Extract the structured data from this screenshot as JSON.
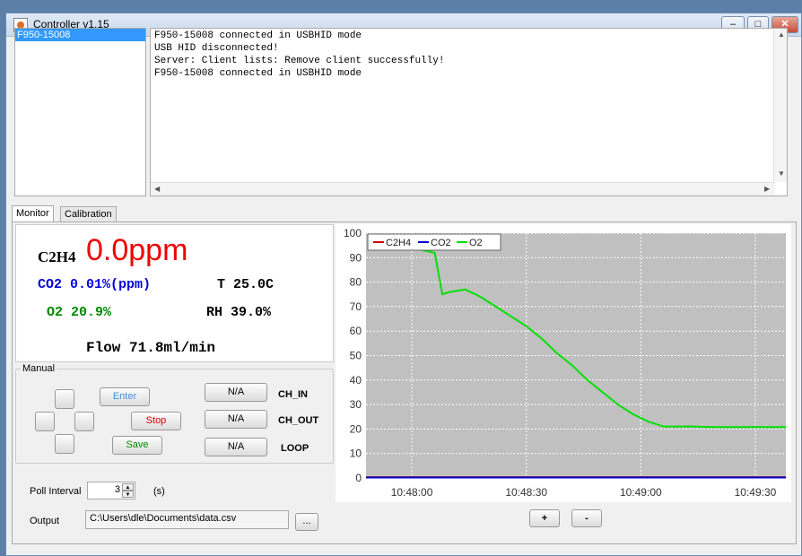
{
  "window": {
    "title": "Controller v1.15",
    "minimize": "–",
    "maximize": "□",
    "close": "✕"
  },
  "devices": [
    "F950-15008"
  ],
  "log": {
    "lines": [
      "F950-15008 connected in USBHID mode",
      "USB HID disconnected!",
      "Server: Client lists: Remove client successfully!",
      "F950-15008 connected in USBHID mode"
    ]
  },
  "tabs": [
    "Monitor",
    "Calibration"
  ],
  "readout": {
    "c2h4_label": "C2H4",
    "c2h4_value": "0.0ppm",
    "co2": "CO2 0.01%(ppm)",
    "temp": "T 25.0C",
    "o2": "O2 20.9%",
    "rh": "RH 39.0%",
    "flow": "Flow 71.8ml/min"
  },
  "manual": {
    "legend": "Manual",
    "enter": "Enter",
    "stop": "Stop",
    "save": "Save",
    "ch_in_btn": "N/A",
    "ch_in_label": "CH_IN",
    "ch_out_btn": "N/A",
    "ch_out_label": "CH_OUT",
    "loop_btn": "N/A",
    "loop_label": "LOOP"
  },
  "poll": {
    "label": "Poll Interval",
    "value": "3",
    "unit": "(s)"
  },
  "output": {
    "label": "Output",
    "path": "C:\\Users\\dle\\Documents\\data.csv",
    "browse": "..."
  },
  "zoom": {
    "in": "+",
    "out": "-"
  },
  "colors": {
    "c2h4": "#cc0000",
    "co2": "#0000cc",
    "o2": "#00e000",
    "plot_bg": "#c0c0c0",
    "accent": "#3399ff"
  },
  "chart_data": {
    "type": "line",
    "title": "",
    "xlabel": "",
    "ylabel": "",
    "ylim": [
      0,
      100
    ],
    "yticks": [
      0,
      10,
      20,
      30,
      40,
      50,
      60,
      70,
      80,
      90,
      100
    ],
    "xticks": [
      "10:48:00",
      "10:48:30",
      "10:49:00",
      "10:49:30"
    ],
    "xlim_seconds_from_first_tick": [
      -12,
      98
    ],
    "legend": "top-left",
    "grid": true,
    "series": [
      {
        "name": "C2H4",
        "color": "#cc0000",
        "x": [
          -12,
          98
        ],
        "y": [
          0.3,
          0.3
        ]
      },
      {
        "name": "CO2",
        "color": "#0000cc",
        "x": [
          -12,
          98
        ],
        "y": [
          0.2,
          0.2
        ]
      },
      {
        "name": "O2",
        "color": "#00e000",
        "x": [
          0,
          6,
          8,
          10,
          14,
          18,
          22,
          26,
          30,
          34,
          38,
          42,
          46,
          50,
          54,
          58,
          62,
          66,
          70,
          74,
          78,
          82,
          86,
          90,
          94,
          98
        ],
        "y": [
          94,
          92,
          75,
          76,
          77,
          74,
          70,
          66,
          62,
          57,
          51,
          46,
          40,
          35,
          30,
          26,
          23,
          21,
          21,
          21,
          20.8,
          20.8,
          20.8,
          20.8,
          20.8,
          20.8
        ]
      }
    ]
  }
}
